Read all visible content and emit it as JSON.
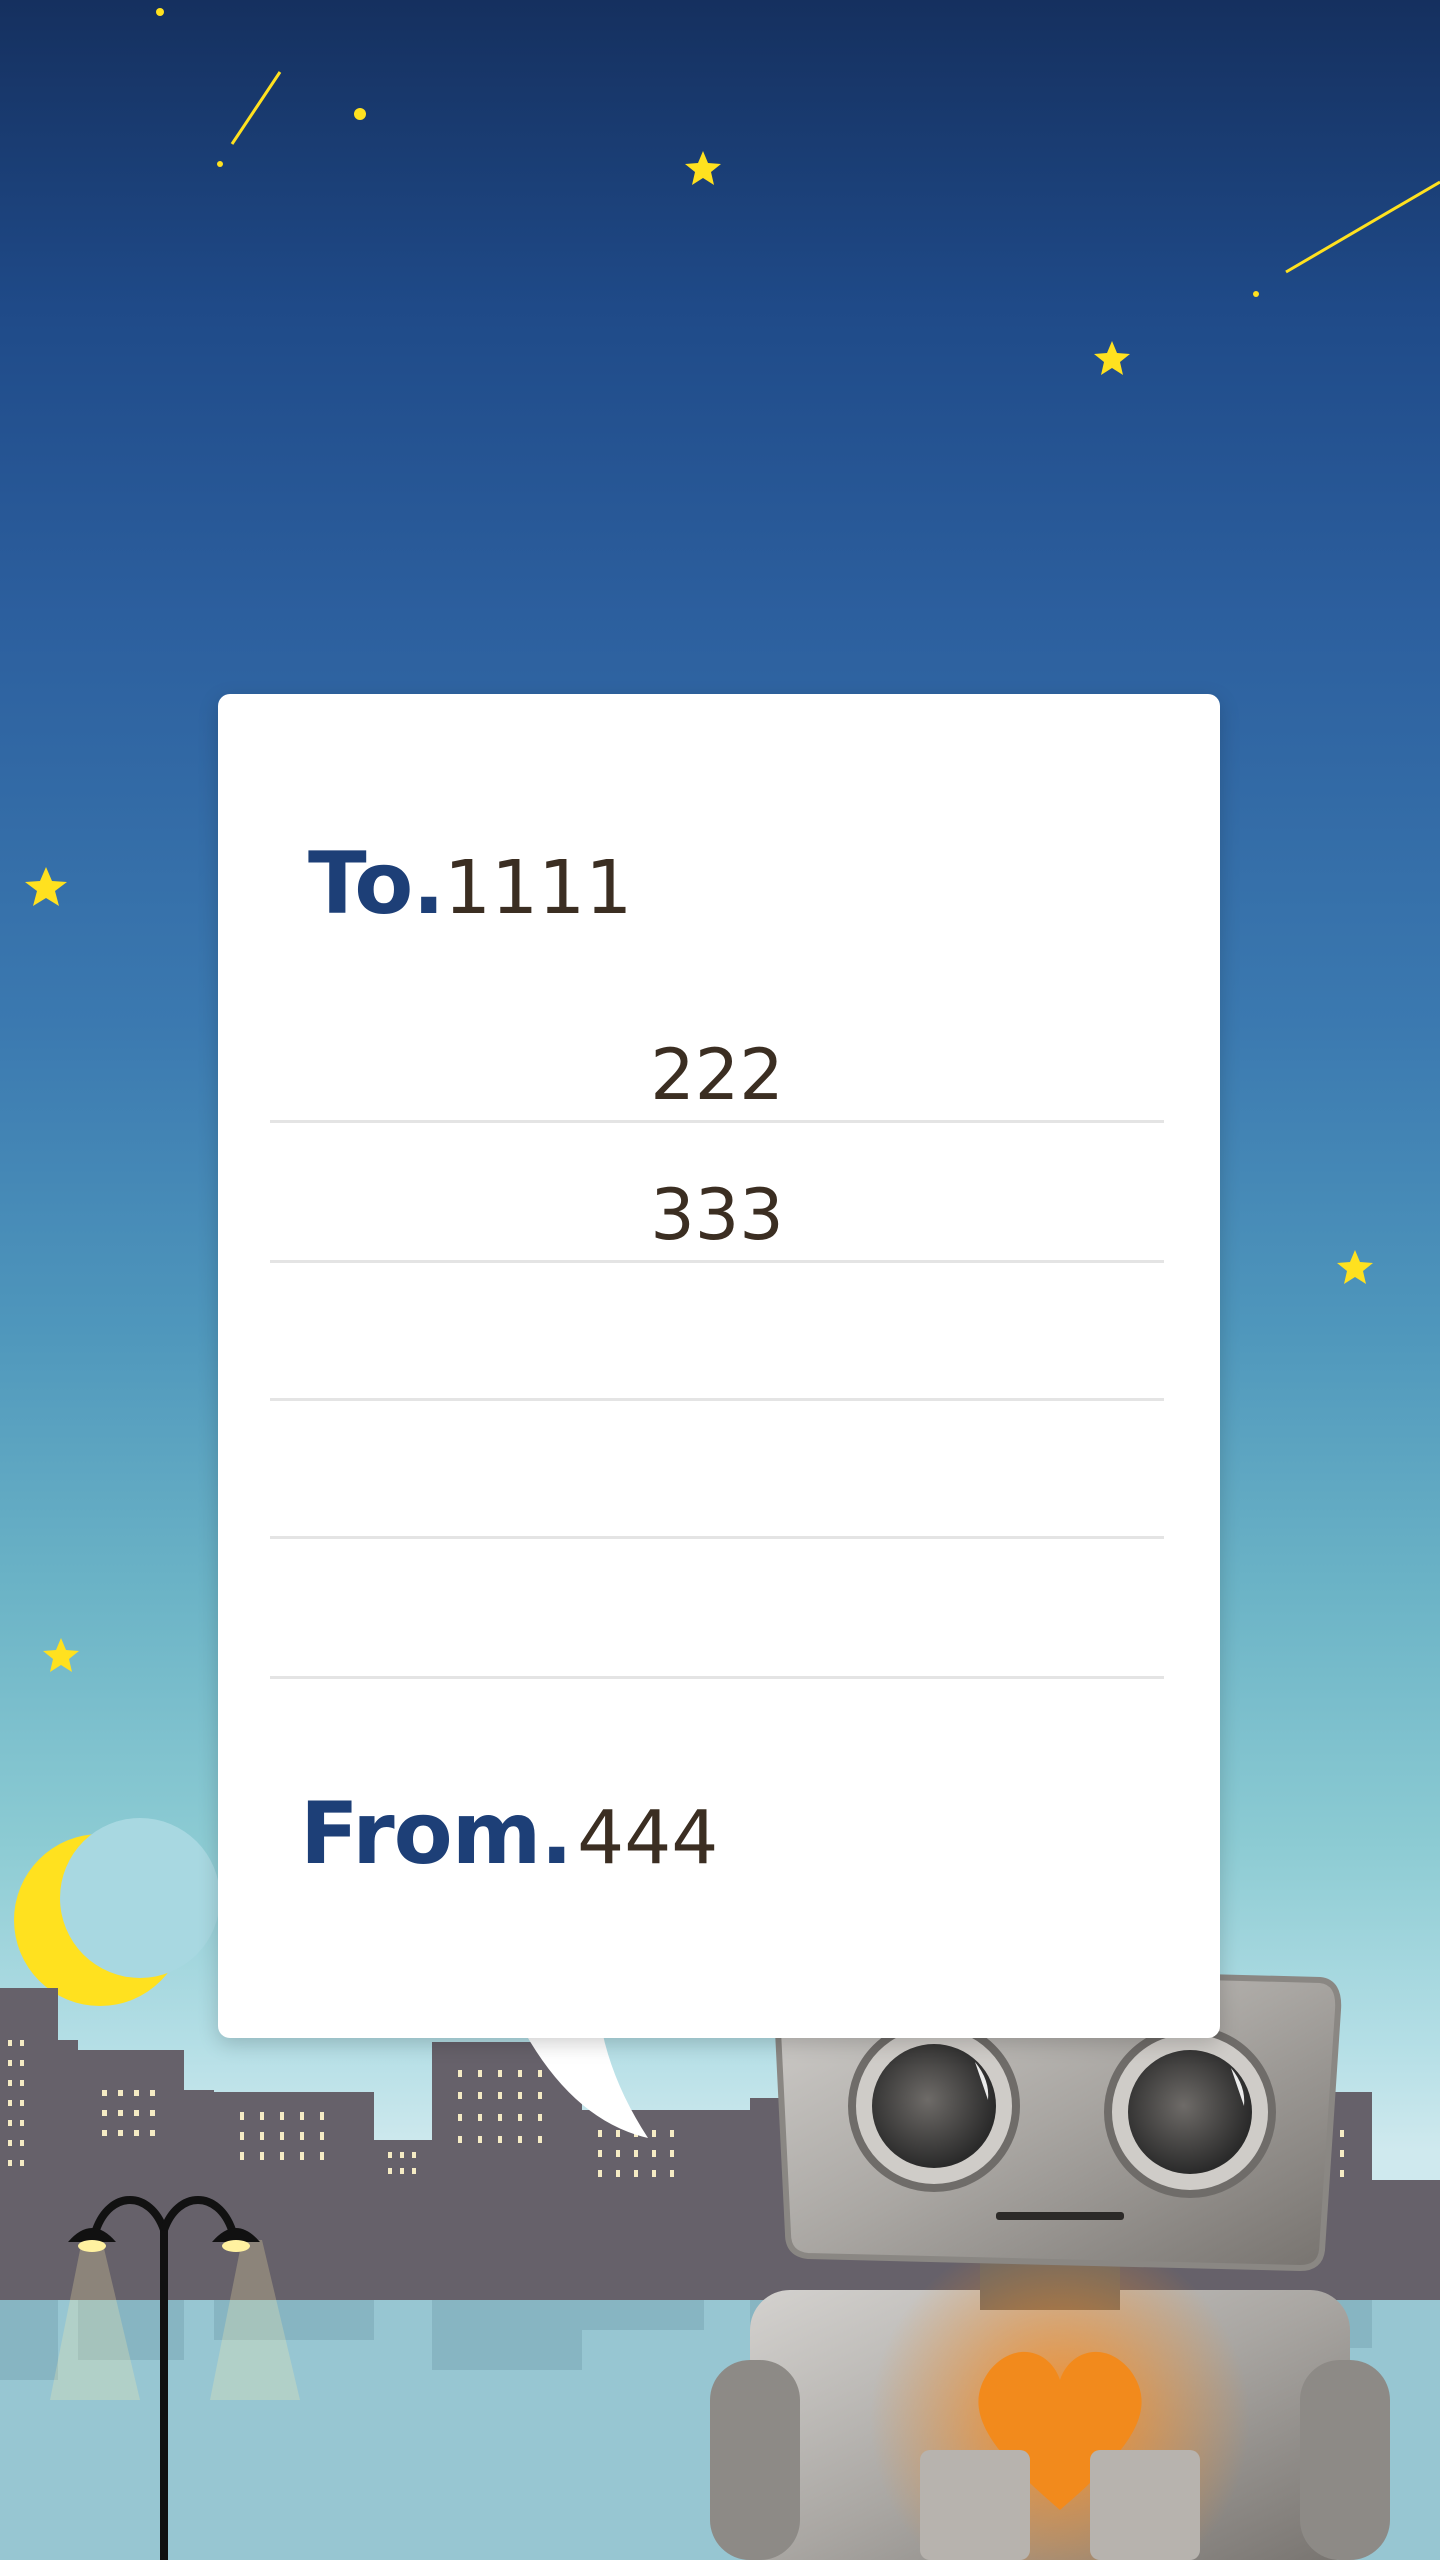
{
  "letter": {
    "to_label": "To.",
    "to_value": "1111",
    "lines": [
      "222",
      "333",
      "",
      "",
      ""
    ],
    "from_label": "From.",
    "from_value": "444"
  },
  "colors": {
    "label_blue": "#1d3f77",
    "text_brown": "#3b2e22",
    "star_yellow": "#ffe11f",
    "city_gray": "#66616a"
  },
  "icons": {
    "moon": "crescent-moon-icon",
    "lamp": "street-lamp-icon",
    "robot": "robot-illustration",
    "heart": "heart-icon"
  }
}
